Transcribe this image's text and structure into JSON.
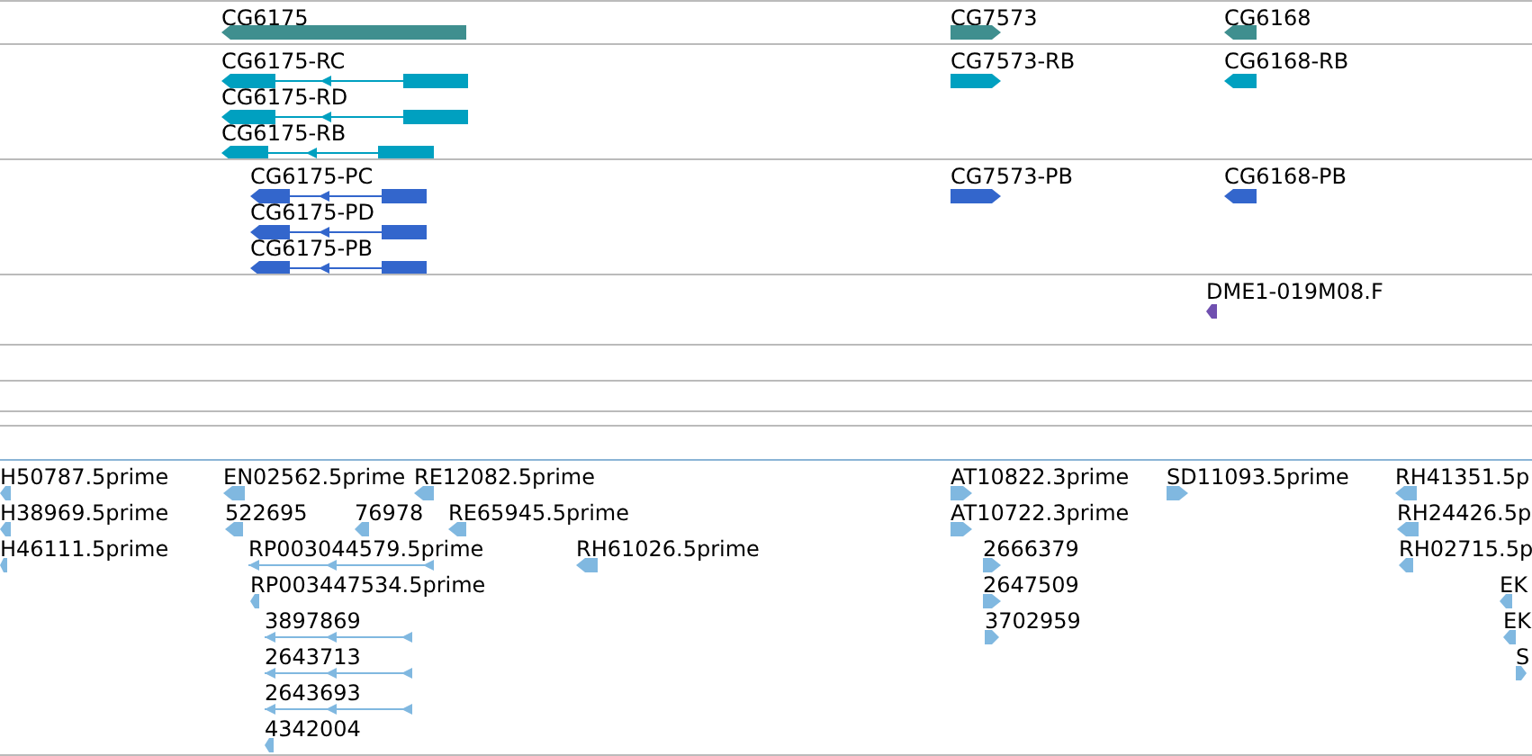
{
  "tracks": [
    {
      "kind": "genes",
      "color": "#3f8f8f",
      "features": [
        {
          "label": "CG6175",
          "kind": "block",
          "reverse": true
        },
        {
          "label": "CG7573",
          "kind": "block",
          "reverse": false
        },
        {
          "label": "CG6168",
          "kind": "block",
          "reverse": true
        }
      ]
    },
    {
      "kind": "transcripts",
      "color": "#00a0c0",
      "features": [
        {
          "label": "CG6175-RC",
          "kind": "spliced",
          "reverse": true
        },
        {
          "label": "CG6175-RD",
          "kind": "spliced",
          "reverse": true
        },
        {
          "label": "CG6175-RB",
          "kind": "spliced",
          "reverse": true
        },
        {
          "label": "CG7573-RB",
          "kind": "block",
          "reverse": false
        },
        {
          "label": "CG6168-RB",
          "kind": "block",
          "reverse": true
        }
      ]
    },
    {
      "kind": "proteins",
      "color": "#3366cc",
      "features": [
        {
          "label": "CG6175-PC",
          "kind": "spliced",
          "reverse": true
        },
        {
          "label": "CG6175-PD",
          "kind": "spliced",
          "reverse": true
        },
        {
          "label": "CG6175-PB",
          "kind": "spliced",
          "reverse": true
        },
        {
          "label": "CG7573-PB",
          "kind": "block",
          "reverse": false
        },
        {
          "label": "CG6168-PB",
          "kind": "block",
          "reverse": true
        }
      ]
    },
    {
      "kind": "clones",
      "color": "#7050b0",
      "features": [
        {
          "label": "DME1-019M08.F",
          "kind": "block",
          "reverse": true
        }
      ]
    },
    {
      "kind": "empty"
    },
    {
      "kind": "empty"
    },
    {
      "kind": "empty"
    },
    {
      "kind": "empty"
    },
    {
      "kind": "ests",
      "color": "#80b8e0",
      "features": [
        {
          "label": "H50787.5prime",
          "kind": "block",
          "reverse": true
        },
        {
          "label": "H38969.5prime",
          "kind": "block",
          "reverse": true
        },
        {
          "label": "H46111.5prime",
          "kind": "block",
          "reverse": true
        },
        {
          "label": "EN02562.5prime",
          "kind": "block",
          "reverse": true
        },
        {
          "label": "RE12082.5prime",
          "kind": "block",
          "reverse": true
        },
        {
          "label": "522695",
          "kind": "block",
          "reverse": true
        },
        {
          "label": "76978",
          "kind": "block",
          "reverse": true
        },
        {
          "label": "RE65945.5prime",
          "kind": "block",
          "reverse": true
        },
        {
          "label": "RP003044579.5prime",
          "kind": "line",
          "reverse": true
        },
        {
          "label": "RH61026.5prime",
          "kind": "block",
          "reverse": true
        },
        {
          "label": "RP003447534.5prime",
          "kind": "block",
          "reverse": true
        },
        {
          "label": "3897869",
          "kind": "line",
          "reverse": true
        },
        {
          "label": "2643713",
          "kind": "line",
          "reverse": true
        },
        {
          "label": "2643693",
          "kind": "line",
          "reverse": true
        },
        {
          "label": "4342004",
          "kind": "block",
          "reverse": true
        },
        {
          "label": "AT10822.3prime",
          "kind": "block",
          "reverse": false
        },
        {
          "label": "AT10722.3prime",
          "kind": "block",
          "reverse": false
        },
        {
          "label": "2666379",
          "kind": "block",
          "reverse": false
        },
        {
          "label": "2647509",
          "kind": "block",
          "reverse": false
        },
        {
          "label": "3702959",
          "kind": "block",
          "reverse": false
        },
        {
          "label": "SD11093.5prime",
          "kind": "block",
          "reverse": false
        },
        {
          "label": "RH41351.5p",
          "kind": "block",
          "reverse": true
        },
        {
          "label": "RH24426.5p",
          "kind": "block",
          "reverse": true
        },
        {
          "label": "RH02715.5p",
          "kind": "block",
          "reverse": true
        },
        {
          "label": "EK",
          "kind": "block",
          "reverse": true
        },
        {
          "label": "EK",
          "kind": "block",
          "reverse": true
        },
        {
          "label": "S",
          "kind": "block",
          "reverse": false
        }
      ]
    }
  ]
}
